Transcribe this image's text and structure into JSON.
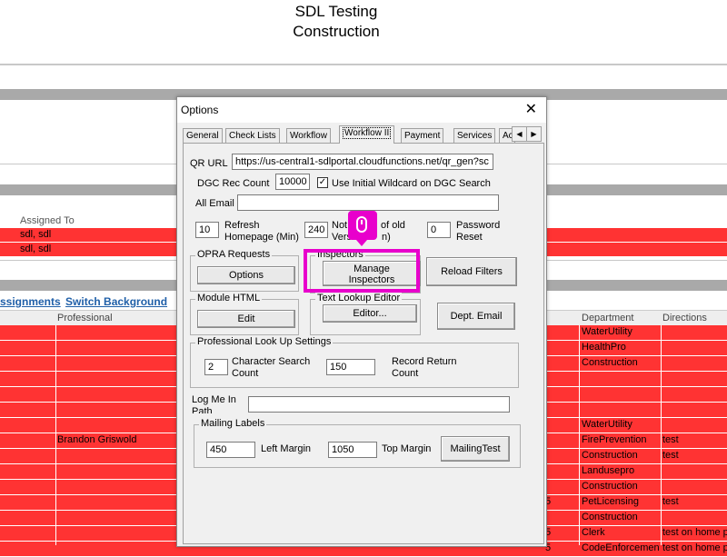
{
  "page": {
    "title_line1": "SDL Testing",
    "title_line2": "Construction",
    "assigned_to_header": "Assigned To",
    "assigned_rows": [
      "sdl, sdl",
      "sdl, sdl"
    ],
    "link_assignments": "ssignments",
    "link_switch_background": "Switch Background",
    "col_professional": "Professional",
    "col_department": "Department",
    "col_directions": "Directions",
    "rows": [
      {
        "professional": "",
        "num": "",
        "department": "WaterUtility",
        "directions": ""
      },
      {
        "professional": "",
        "num": "",
        "department": "HealthPro",
        "directions": ""
      },
      {
        "professional": "",
        "num": "",
        "department": "Construction",
        "directions": ""
      },
      {
        "professional": "",
        "num": "",
        "department": "",
        "directions": ""
      },
      {
        "professional": "",
        "num": "",
        "department": "",
        "directions": ""
      },
      {
        "professional": "",
        "num": "",
        "department": "",
        "directions": ""
      },
      {
        "professional": "",
        "num": "",
        "department": "WaterUtility",
        "directions": ""
      },
      {
        "professional": "Brandon Griswold",
        "num": "",
        "department": "FirePrevention",
        "directions": "test"
      },
      {
        "professional": "",
        "num": "",
        "department": "Construction",
        "directions": "test"
      },
      {
        "professional": "",
        "num": "",
        "department": "Landusepro",
        "directions": ""
      },
      {
        "professional": "",
        "num": "",
        "department": "Construction",
        "directions": ""
      },
      {
        "professional": "",
        "num": "5",
        "department": "PetLicensing",
        "directions": "test"
      },
      {
        "professional": "",
        "num": "",
        "department": "Construction",
        "directions": ""
      },
      {
        "professional": "",
        "num": "5",
        "department": "Clerk",
        "directions": "test on home p"
      },
      {
        "professional": "",
        "num": "5",
        "department": "CodeEnforcement",
        "directions": "test on home p"
      }
    ]
  },
  "dialog": {
    "title": "Options",
    "close_symbol": "✕",
    "tabs": [
      "General",
      "Check Lists",
      "Workflow",
      "Workflow II",
      "Payment",
      "Services",
      "Ac"
    ],
    "active_tab": "Workflow II",
    "qr_url_label": "QR URL",
    "qr_url_value": "https://us-central1-sdlportal.cloudfunctions.net/qr_gen?sc",
    "dgc_rec_count_label": "DGC Rec Count",
    "dgc_rec_count_value": "10000",
    "use_wildcard_label": "Use Initial Wildcard on DGC Search",
    "use_wildcard_checked": true,
    "all_email_label": "All Email",
    "all_email_value": "",
    "refresh_value": "10",
    "refresh_label_1": "Refresh",
    "refresh_label_2": "Homepage (Min)",
    "notify_value": "240",
    "notify_label_1": "Not",
    "notify_label_1b": "of old",
    "notify_label_2": "Vers",
    "notify_label_2b": "n)",
    "password_reset_value": "0",
    "password_reset_label_1": "Password",
    "password_reset_label_2": "Reset",
    "opra_group": "OPRA Requests",
    "options_button": "Options",
    "inspectors_group": "Inspectors",
    "manage_inspectors_1": "Manage",
    "manage_inspectors_2": "Inspectors",
    "reload_filters_button": "Reload Filters",
    "module_html_group": "Module HTML",
    "edit_button": "Edit",
    "text_lookup_group": "Text Lookup Editor",
    "editor_button": "Editor...",
    "dept_email_button": "Dept. Email",
    "professional_lookup_group": "Professional Look Up Settings",
    "char_search_value": "2",
    "char_search_label_1": "Character Search",
    "char_search_label_2": "Count",
    "record_return_value": "150",
    "record_return_label_1": "Record Return",
    "record_return_label_2": "Count",
    "log_me_in_label_1": "Log Me In",
    "log_me_in_label_2": "Path",
    "log_me_in_value": "",
    "mailing_labels_group": "Mailing Labels",
    "left_margin_value": "450",
    "left_margin_label": "Left Margin",
    "top_margin_value": "1050",
    "top_margin_label": "Top Margin",
    "mailing_test_button": "MailingTest"
  },
  "colors": {
    "accent_highlight": "#e800cc",
    "row_red": "#ff3333"
  }
}
